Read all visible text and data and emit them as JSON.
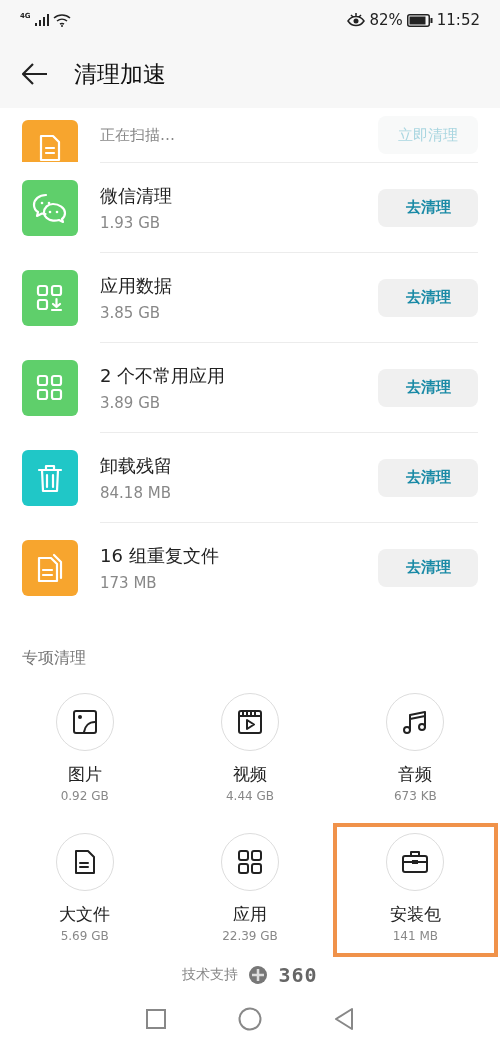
{
  "status_bar": {
    "network": "4G",
    "battery": "82%",
    "time": "11:52"
  },
  "header": {
    "title": "清理加速"
  },
  "clean_items": [
    {
      "kind": "doc",
      "color": "#f7a52e",
      "subtitle": "正在扫描…",
      "action": "立即清理",
      "disabled": true
    },
    {
      "kind": "chat",
      "color": "#5fcf6b",
      "title": "微信清理",
      "subtitle": "1.93 GB",
      "action": "去清理",
      "disabled": false
    },
    {
      "kind": "apps-download",
      "color": "#5fcf6b",
      "title": "应用数据",
      "subtitle": "3.85 GB",
      "action": "去清理",
      "disabled": false
    },
    {
      "kind": "apps",
      "color": "#5fcf6b",
      "title": "2 个不常用应用",
      "subtitle": "3.89 GB",
      "action": "去清理",
      "disabled": false
    },
    {
      "kind": "trash",
      "color": "#20c7c7",
      "title": "卸载残留",
      "subtitle": "84.18 MB",
      "action": "去清理",
      "disabled": false
    },
    {
      "kind": "docs",
      "color": "#f7a52e",
      "title": "16 组重复文件",
      "subtitle": "173 MB",
      "action": "去清理",
      "disabled": false
    }
  ],
  "special": {
    "title": "专项清理",
    "items": [
      {
        "kind": "image",
        "label": "图片",
        "size": "0.92 GB",
        "highlighted": false
      },
      {
        "kind": "video",
        "label": "视频",
        "size": "4.44 GB",
        "highlighted": false
      },
      {
        "kind": "music",
        "label": "音频",
        "size": "673 KB",
        "highlighted": false
      },
      {
        "kind": "file",
        "label": "大文件",
        "size": "5.69 GB",
        "highlighted": false
      },
      {
        "kind": "apps",
        "label": "应用",
        "size": "22.39 GB",
        "highlighted": false
      },
      {
        "kind": "briefcase",
        "label": "安装包",
        "size": "141 MB",
        "highlighted": true
      }
    ]
  },
  "footer": {
    "label": "技术支持",
    "brand": "360"
  }
}
